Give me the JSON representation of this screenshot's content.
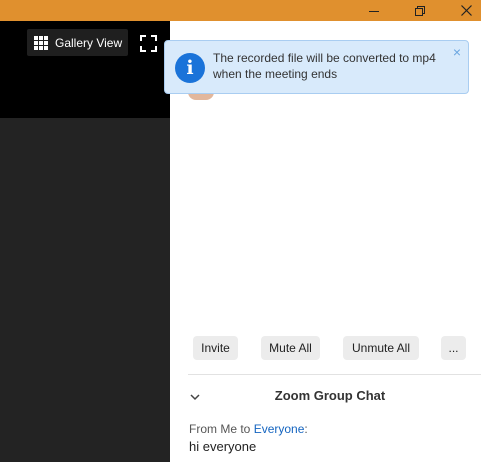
{
  "titlebar": {
    "color": "#e0902e",
    "controls": [
      "minimize-icon",
      "restore-icon",
      "close-icon"
    ]
  },
  "video": {
    "gallery_label": "Gallery View",
    "gallery_icon": "grid-icon",
    "fullscreen_icon": "fullscreen-icon"
  },
  "notification": {
    "message": "The recorded file will be converted to mp4 when the meeting ends",
    "info_icon": "i",
    "close_glyph": "×",
    "accent": "#1a73d9"
  },
  "participants": {
    "invite_label": "Invite",
    "mute_all_label": "Mute All",
    "unmute_all_label": "Unmute All",
    "more_label": "..."
  },
  "chat": {
    "title": "Zoom Group Chat",
    "message": {
      "prefix": "From Me to ",
      "recipient": "Everyone",
      "suffix": ":",
      "text": "hi everyone"
    },
    "link_color": "#1565c0"
  }
}
